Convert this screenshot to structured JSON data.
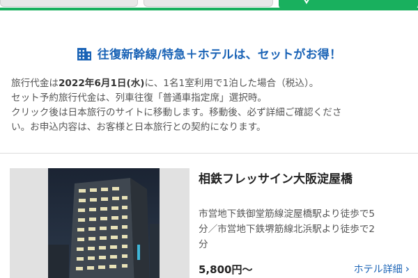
{
  "tabs": {
    "items": [
      "",
      "",
      ""
    ],
    "active_color": "#19b05e"
  },
  "heading": {
    "text": "往復新幹線/特急＋ホテルは、セットがお得！",
    "icon": "building-icon",
    "color": "#1a63b6"
  },
  "notice": {
    "line1_prefix": "旅行代金は",
    "line1_date": "2022年6月1日(水)",
    "line1_suffix": "に、1名1室利用で1泊した場合（税込）。",
    "line2": "セット予約旅行代金は、列車往復「普通車指定席」選択時。",
    "line3": "クリック後は日本旅行のサイトに移動します。移動後、必ず詳細ご確認くださ",
    "line4": "い。お申込内容は、お客様と日本旅行との契約になります。"
  },
  "hotel": {
    "name": "相鉄フレッサイン大阪淀屋橋",
    "access_line1": "市営地下鉄御堂筋線淀屋橋駅より徒歩で5",
    "access_line2": "分／市営地下鉄堺筋線北浜駅より徒歩で2",
    "access_line3": "分",
    "price": "5,800円～",
    "detail_link": "ホテル詳細",
    "detail_icon": "chevron-right-icon"
  }
}
